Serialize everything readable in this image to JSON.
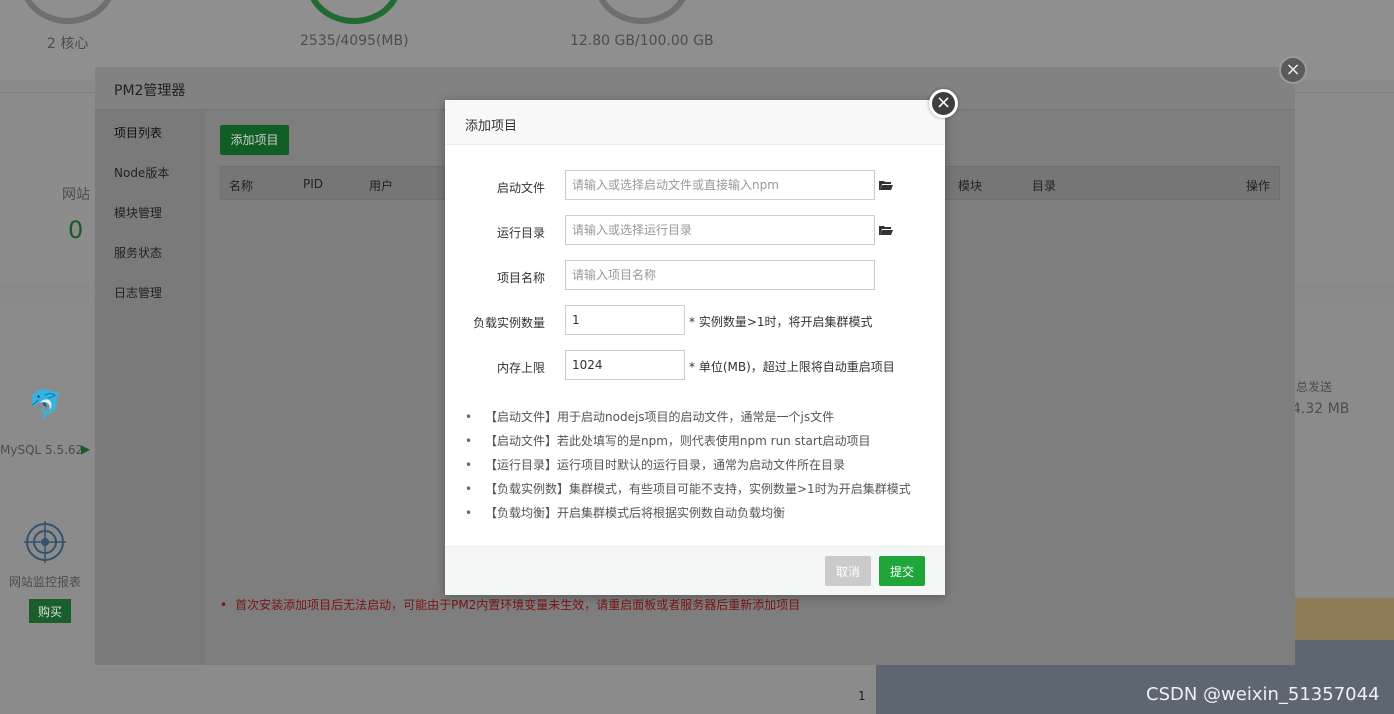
{
  "background": {
    "cpu_text": "2 核心",
    "memory_text": "2535/4095(MB)",
    "disk_text": "12.80 GB/100.00 GB",
    "website_label": "网站",
    "website_count": "0",
    "mysql_label": "MySQL 5.5.62",
    "monitor_label": "网站监控报表",
    "buy_label": "购买",
    "traffic_label": "总发送",
    "traffic_value": "4.32 MB",
    "chart_tick": "1",
    "watermark": "CSDN @weixin_51357044"
  },
  "pm2": {
    "title": "PM2管理器",
    "sidebar": [
      "项目列表",
      "Node版本",
      "模块管理",
      "服务状态",
      "日志管理"
    ],
    "add_button": "添加项目",
    "columns": [
      "名称",
      "PID",
      "用户",
      "模块",
      "目录",
      "操作"
    ],
    "warning": "首次安装添加项目后无法启动，可能由于PM2内置环境变量未生效，请重启面板或者服务器后重新添加项目",
    "close_icon": "×"
  },
  "dialog": {
    "title": "添加项目",
    "close_icon": "×",
    "fields": {
      "start_file": {
        "label": "启动文件",
        "placeholder": "请输入或选择启动文件或直接输入npm",
        "value": ""
      },
      "run_dir": {
        "label": "运行目录",
        "placeholder": "请输入或选择运行目录",
        "value": ""
      },
      "project_name": {
        "label": "项目名称",
        "placeholder": "请输入项目名称",
        "value": ""
      },
      "instances": {
        "label": "负载实例数量",
        "value": "1",
        "hint": "* 实例数量>1时，将开启集群模式"
      },
      "memory_limit": {
        "label": "内存上限",
        "value": "1024",
        "hint": "* 单位(MB)，超过上限将自动重启项目"
      }
    },
    "notes": [
      "【启动文件】用于启动nodejs项目的启动文件，通常是一个js文件",
      "【启动文件】若此处填写的是npm，则代表使用npm run start启动项目",
      "【运行目录】运行项目时默认的运行目录，通常为启动文件所在目录",
      "【负载实例数】集群模式，有些项目可能不支持，实例数量>1时为开启集群模式",
      "【负载均衡】开启集群模式后将根据实例数自动负载均衡"
    ],
    "cancel_label": "取消",
    "submit_label": "提交"
  }
}
